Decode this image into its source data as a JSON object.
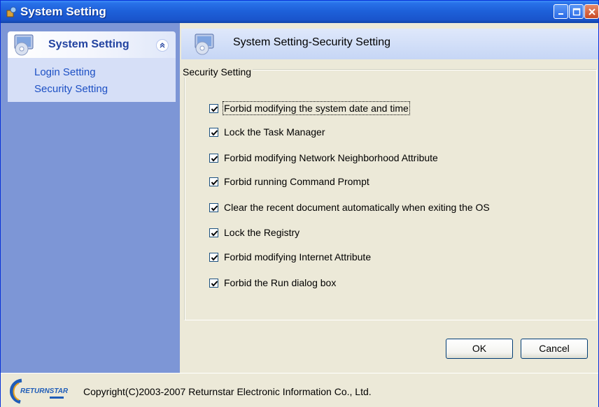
{
  "window": {
    "title": "System Setting",
    "icon": "app-icon"
  },
  "sidebar": {
    "group_title": "System Setting",
    "links": [
      "Login Setting",
      "Security Setting"
    ]
  },
  "content": {
    "header_title": "System Setting-Security Setting",
    "section_label": "Security Setting",
    "options": [
      {
        "label": "Forbid modifying the system date and time",
        "checked": true
      },
      {
        "label": "Lock the Task Manager",
        "checked": true
      },
      {
        "label": "Forbid modifying Network Neighborhood Attribute",
        "checked": true
      },
      {
        "label": "Forbid running Command Prompt",
        "checked": true
      },
      {
        "label": "Clear the recent document automatically when exiting the OS",
        "checked": true
      },
      {
        "label": "Lock the Registry",
        "checked": true
      },
      {
        "label": "Forbid modifying Internet Attribute",
        "checked": true
      },
      {
        "label": "Forbid the Run dialog box",
        "checked": true
      }
    ]
  },
  "buttons": {
    "ok": "OK",
    "cancel": "Cancel"
  },
  "footer": {
    "copyright": "Copyright(C)2003-2007 Returnstar Electronic Information Co., Ltd.",
    "logo_text": "RETURNSTAR"
  },
  "colors": {
    "titlebar": "#1d5fd8",
    "sidebar": "#7d96d6",
    "link": "#1d50c4"
  }
}
